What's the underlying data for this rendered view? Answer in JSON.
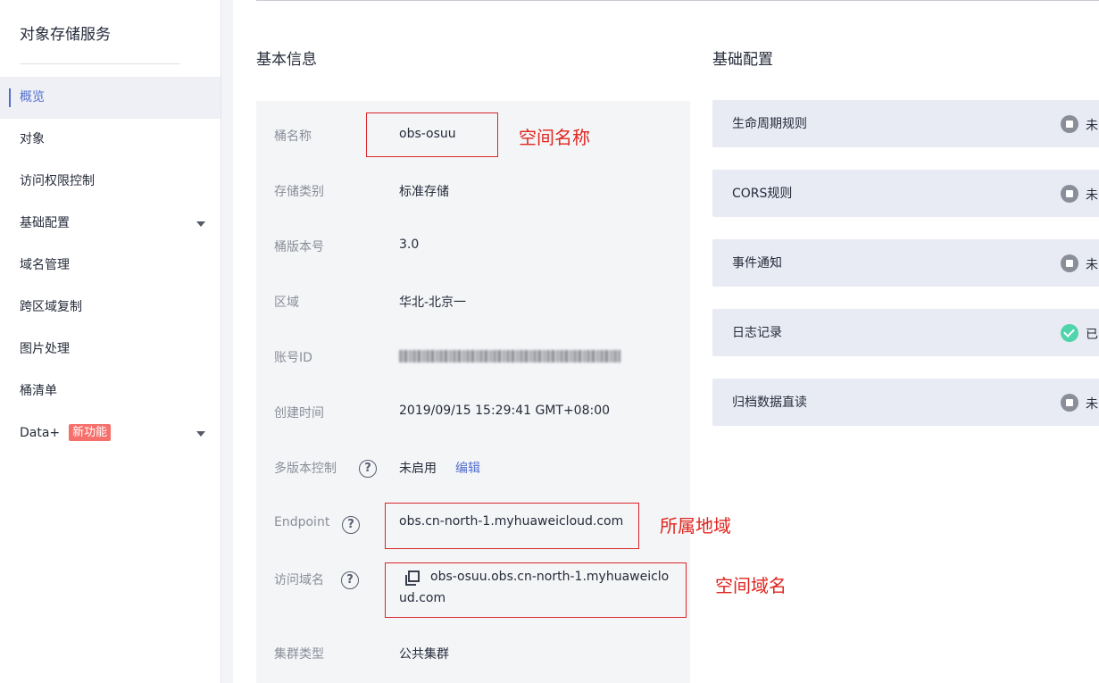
{
  "sidebar": {
    "title": "对象存储服务",
    "items": [
      {
        "label": "概览"
      },
      {
        "label": "对象"
      },
      {
        "label": "访问权限控制"
      },
      {
        "label": "基础配置"
      },
      {
        "label": "域名管理"
      },
      {
        "label": "跨区域复制"
      },
      {
        "label": "图片处理"
      },
      {
        "label": "桶清单"
      },
      {
        "label": "Data+",
        "badge": "新功能"
      }
    ]
  },
  "basic_info": {
    "title": "基本信息",
    "bucket_name": {
      "label": "桶名称",
      "value": "obs-osuu"
    },
    "storage_class": {
      "label": "存储类别",
      "value": "标准存储"
    },
    "bucket_version": {
      "label": "桶版本号",
      "value": "3.0"
    },
    "region": {
      "label": "区域",
      "value": "华北-北京一"
    },
    "account_id": {
      "label": "账号ID"
    },
    "created": {
      "label": "创建时间",
      "value": "2019/09/15 15:29:41 GMT+08:00"
    },
    "versioning": {
      "label": "多版本控制",
      "value": "未启用",
      "edit": "编辑"
    },
    "endpoint": {
      "label": "Endpoint",
      "value": "obs.cn-north-1.myhuaweicloud.com"
    },
    "access_domain": {
      "label": "访问域名",
      "value_line1": "obs-osuu.obs.cn-north-1.myhuaweiclo",
      "value_line2": "ud.com"
    },
    "cluster_type": {
      "label": "集群类型",
      "value": "公共集群"
    }
  },
  "annotations": {
    "bucket_name": "空间名称",
    "endpoint": "所属地域",
    "access_domain": "空间域名"
  },
  "basic_config": {
    "title": "基础配置",
    "items": [
      {
        "label": "生命周期规则",
        "status": "未",
        "state": "off"
      },
      {
        "label": "CORS规则",
        "status": "未",
        "state": "off"
      },
      {
        "label": "事件通知",
        "status": "未",
        "state": "off"
      },
      {
        "label": "日志记录",
        "status": "已",
        "state": "on"
      },
      {
        "label": "归档数据直读",
        "status": "未",
        "state": "off"
      }
    ]
  },
  "colors": {
    "accent": "#526ecc",
    "annotation_red": "#e0251f",
    "badge_red": "#f66f6a",
    "status_on": "#50d4ab",
    "status_off": "#8a8e99"
  }
}
